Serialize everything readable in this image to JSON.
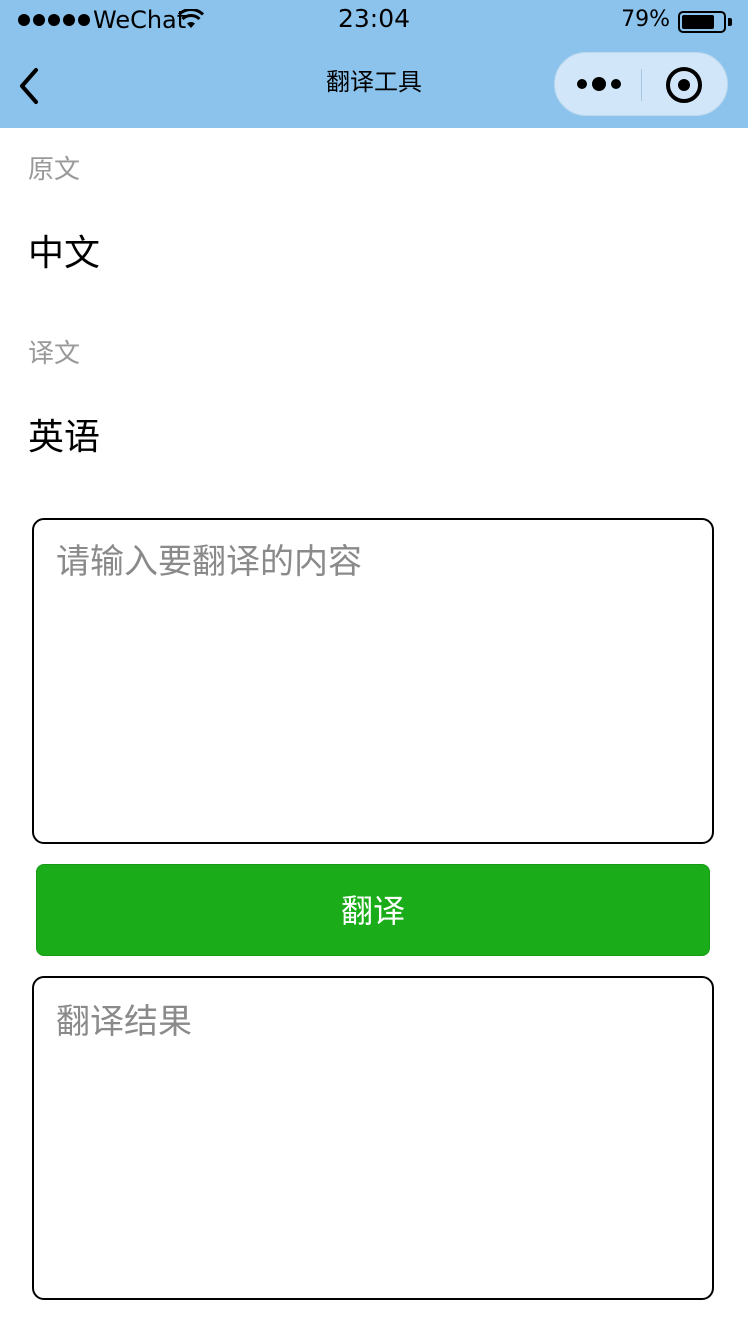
{
  "status_bar": {
    "carrier": "WeChat",
    "time": "23:04",
    "battery_percent": "79%",
    "battery_level": 0.79
  },
  "nav": {
    "title": "翻译工具",
    "back_icon": "chevron-left-icon",
    "menu_icon": "more-dots-icon",
    "close_icon": "target-close-icon"
  },
  "source": {
    "label": "原文",
    "value": "中文"
  },
  "target": {
    "label": "译文",
    "value": "英语"
  },
  "input": {
    "placeholder": "请输入要翻译的内容"
  },
  "translate_button": {
    "label": "翻译"
  },
  "result": {
    "placeholder": "翻译结果"
  },
  "colors": {
    "header_bg": "#8bc3ec",
    "button_green": "#1aad19",
    "label_gray": "#999999"
  }
}
